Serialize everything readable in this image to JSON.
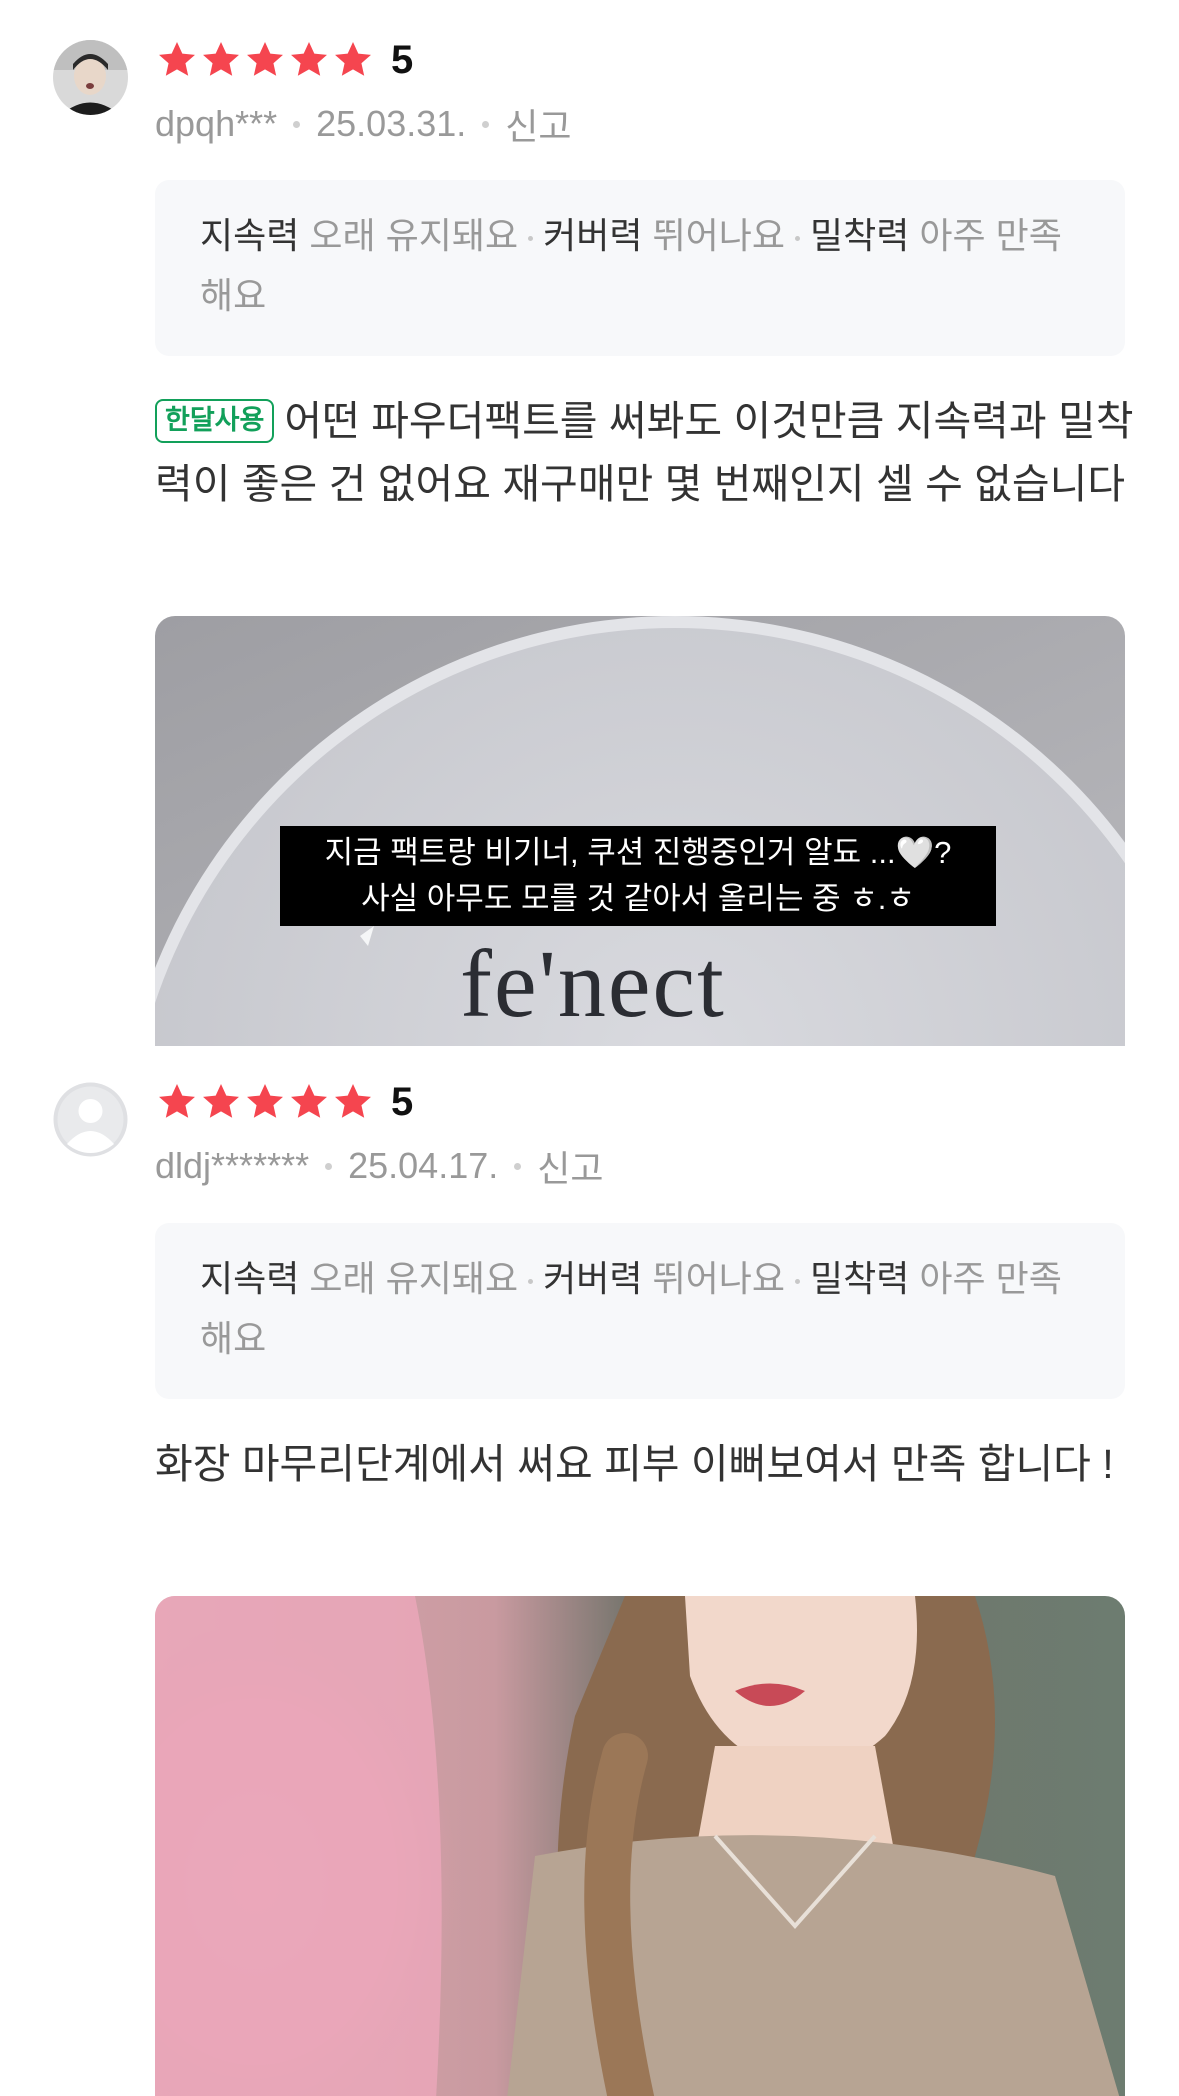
{
  "reviews": [
    {
      "user": "dpqh***",
      "rating": 5,
      "rating_label": "5",
      "date": "25.03.31.",
      "report_label": "신고",
      "attributes": [
        {
          "key": "지속력",
          "value": "오래 유지돼요"
        },
        {
          "key": "커버력",
          "value": "뛰어나요"
        },
        {
          "key": "밀착력",
          "value": "아주 만족해요"
        }
      ],
      "badge": "한달사용",
      "text": "어떤 파우더팩트를 써봐도 이것만큼 지속력과 밀착력이 좋은 건 없어요 재구매만 몇 번째인지 셀 수 없습니다",
      "photo": {
        "caption_line1": "지금 팩트랑 비기너, 쿠션 진행중인거 알됴 ...🤍?",
        "caption_line2": "사실 아무도 모를 것 같아서 올리는 중 ㅎ.ㅎ",
        "brand": "fe'nect"
      }
    },
    {
      "user": "dldj*******",
      "rating": 5,
      "rating_label": "5",
      "date": "25.04.17.",
      "report_label": "신고",
      "attributes": [
        {
          "key": "지속력",
          "value": "오래 유지돼요"
        },
        {
          "key": "커버력",
          "value": "뛰어나요"
        },
        {
          "key": "밀착력",
          "value": "아주 만족해요"
        }
      ],
      "text": "화장 마무리단계에서 써요 피부 이뻐보여서 만족 합니다 !"
    }
  ],
  "colors": {
    "star": "#f5454f",
    "badge_green": "#12a05a",
    "meta_gray": "#999999",
    "attr_bg": "#f7f8fa"
  },
  "icons": {
    "star": "star-icon",
    "default_avatar": "person-icon"
  }
}
